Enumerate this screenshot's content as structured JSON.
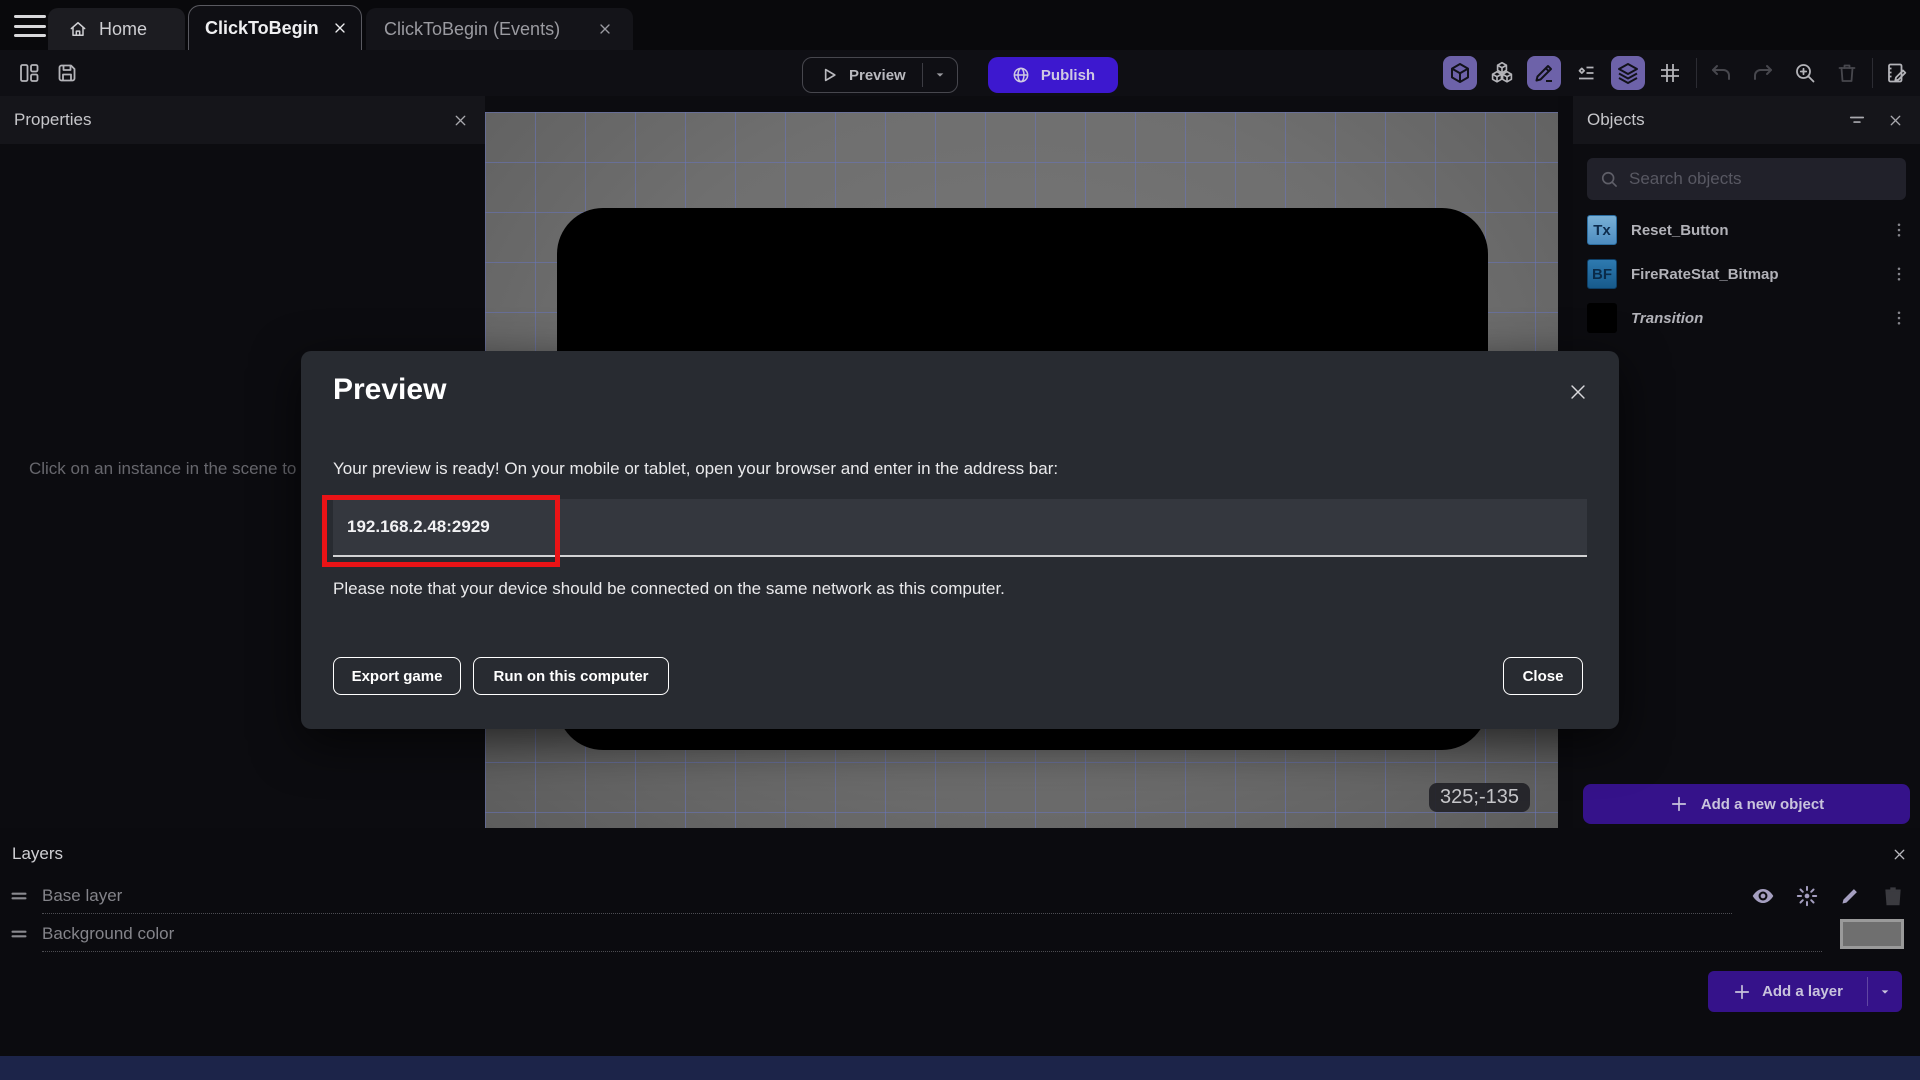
{
  "tab_bar": {
    "tabs": [
      {
        "label": "Home"
      },
      {
        "label": "ClickToBegin"
      },
      {
        "label": "ClickToBegin (Events)"
      }
    ]
  },
  "toolbar": {
    "preview_label": "Preview",
    "publish_label": "Publish"
  },
  "properties_panel": {
    "title": "Properties",
    "empty_message": "Click on an instance in the scene to display its properties"
  },
  "canvas": {
    "coordinates_badge": "325;-135"
  },
  "objects_panel": {
    "title": "Objects",
    "search_placeholder": "Search objects",
    "items": [
      {
        "name": "Reset_Button",
        "icon_text": "Tx"
      },
      {
        "name": "FireRateStat_Bitmap",
        "icon_text": "BF"
      },
      {
        "name": "Transition",
        "icon_text": ""
      }
    ],
    "add_object_label": "Add a new object"
  },
  "preview_dialog": {
    "title": "Preview",
    "message": "Your preview is ready! On your mobile or tablet, open your browser and enter in the address bar:",
    "address": "192.168.2.48:2929",
    "note": "Please note that your device should be connected on the same network as this computer.",
    "export_label": "Export game",
    "run_label": "Run on this computer",
    "close_label": "Close"
  },
  "layers_panel": {
    "title": "Layers",
    "layers": [
      {
        "name": "Base layer"
      },
      {
        "name": "Background color"
      }
    ],
    "add_layer_label": "Add a layer"
  },
  "colors": {
    "publish_purple": "#3d18cf",
    "deep_purple": "#35128a",
    "active_icon_purple": "#6d62a9",
    "annotation_red": "#ea1316",
    "canvas_gray": "#6f6f6f",
    "grid_blue": "#6875bc"
  }
}
